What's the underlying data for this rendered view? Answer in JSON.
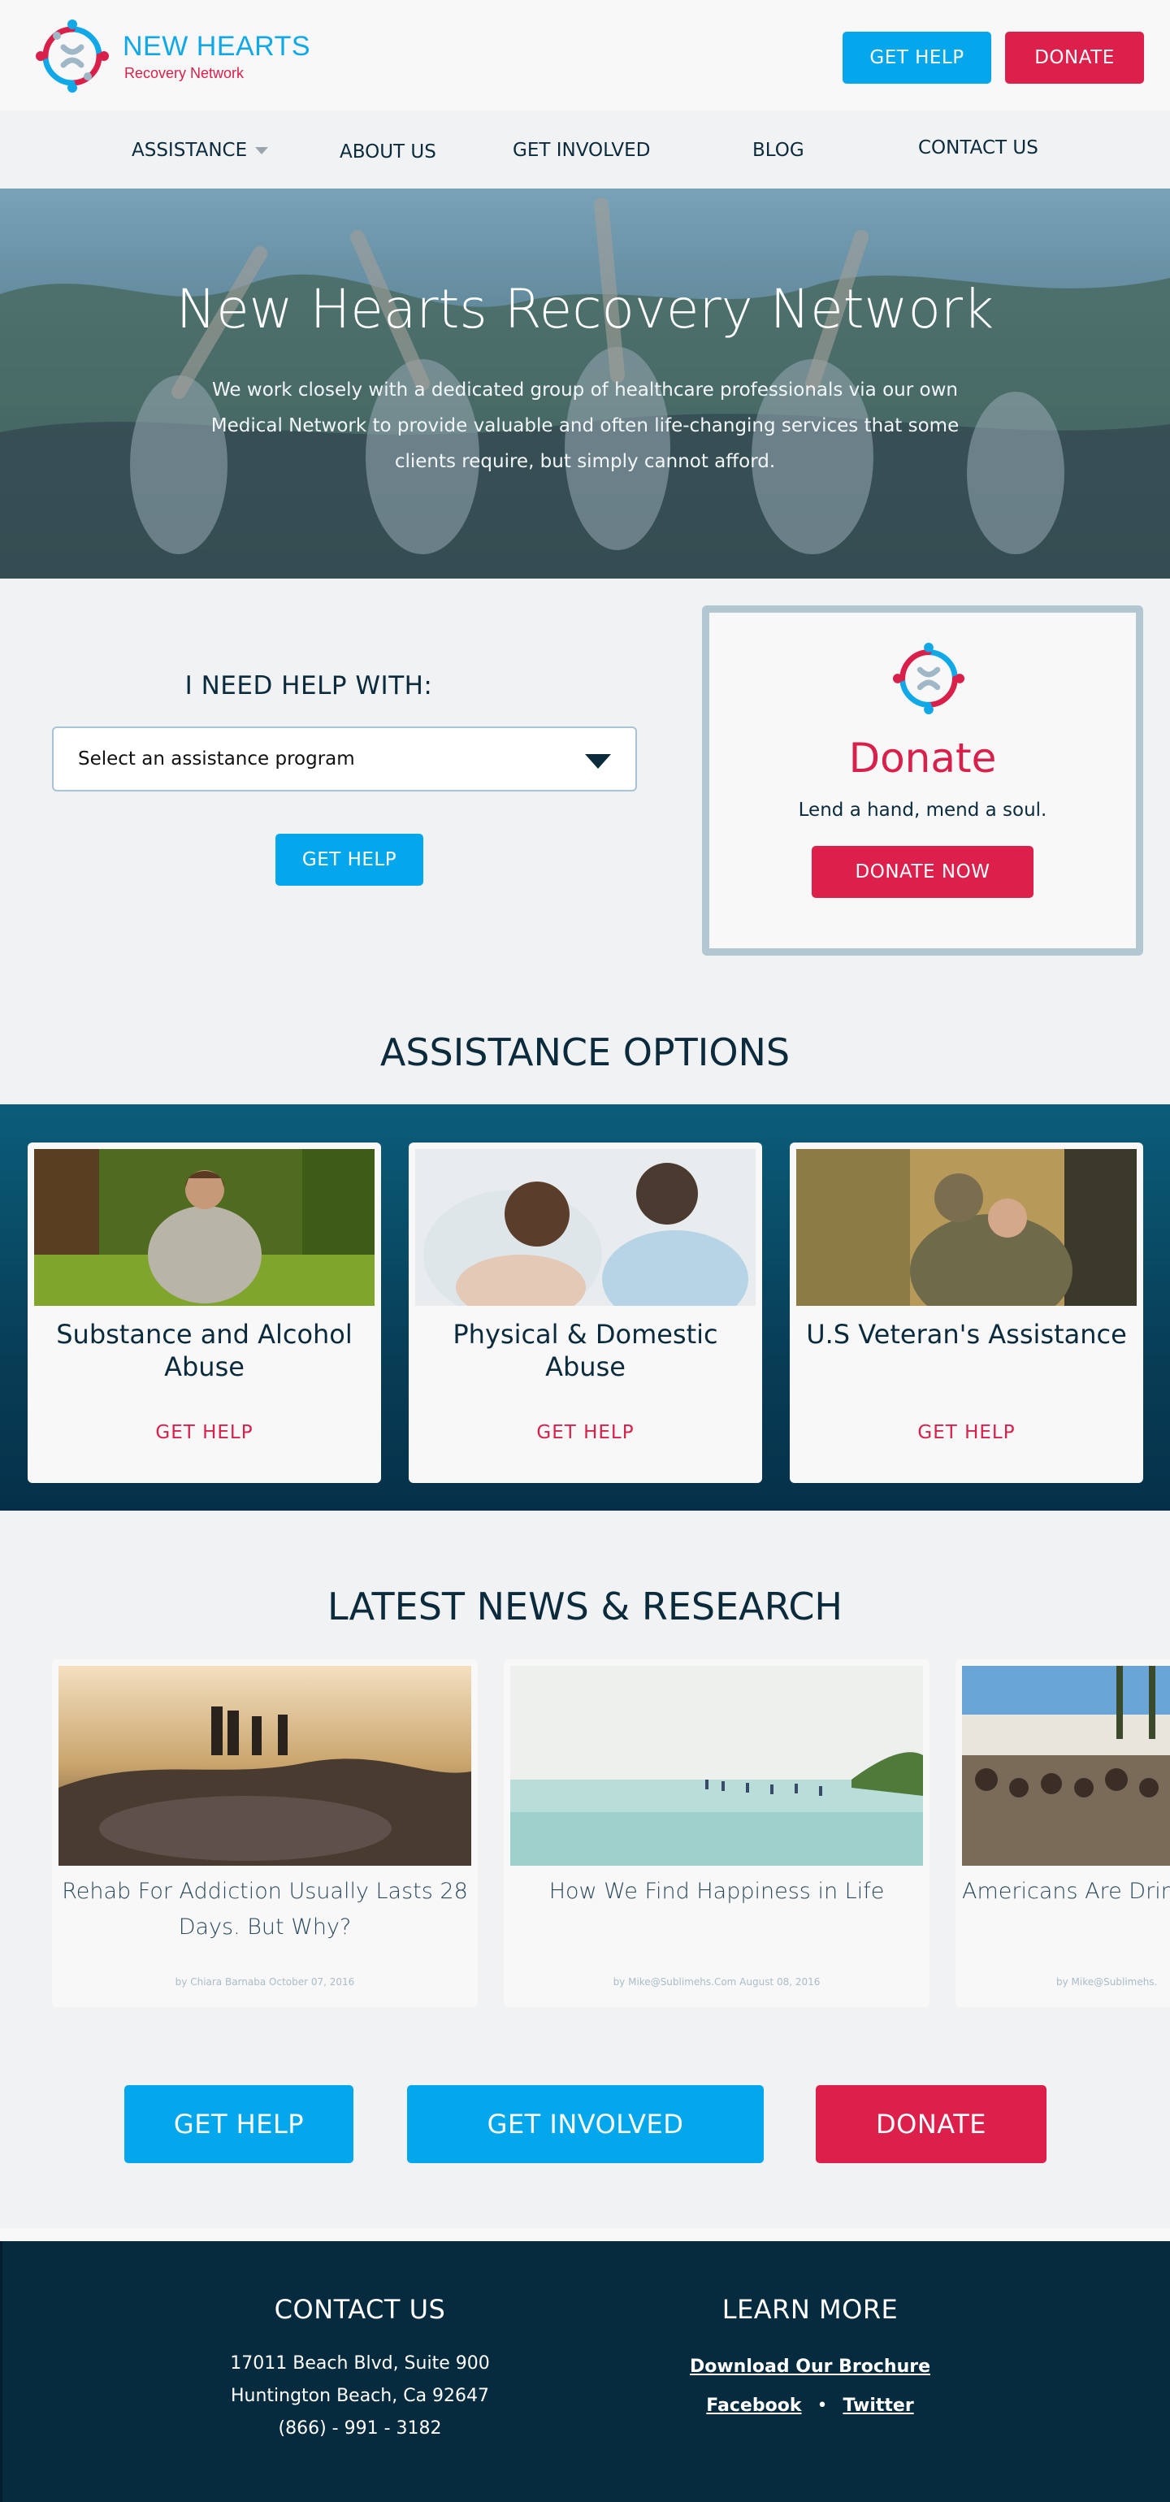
{
  "header": {
    "brand_name": "NEW HEARTS",
    "brand_sub": "Recovery Network",
    "get_help": "GET HELP",
    "donate": "DONATE"
  },
  "nav": {
    "assistance": "ASSISTANCE",
    "about": "ABOUT US",
    "involved": "GET INVOLVED",
    "blog": "BLOG",
    "contact": "CONTACT US"
  },
  "hero": {
    "title": "New Hearts Recovery Network",
    "text": "We work closely with a dedicated group of healthcare professionals via our own Medical Network to provide valuable and often life-changing services that some clients require, but simply cannot afford."
  },
  "help": {
    "heading": "I NEED HELP WITH:",
    "select_value": "Select an assistance program",
    "button": "GET HELP"
  },
  "donate_box": {
    "title": "Donate",
    "tagline": "Lend a hand, mend a soul.",
    "button": "DONATE NOW"
  },
  "assistance": {
    "heading": "ASSISTANCE OPTIONS",
    "cards": [
      {
        "title": "Substance and Alcohol Abuse",
        "link": "GET HELP"
      },
      {
        "title": "Physical & Domestic Abuse",
        "link": "GET HELP"
      },
      {
        "title": "U.S Veteran's Assistance",
        "link": "GET HELP"
      }
    ]
  },
  "news": {
    "heading": "LATEST NEWS & RESEARCH",
    "items": [
      {
        "title": "Rehab For Addiction Usually Lasts 28 Days. But Why?",
        "meta": "by Chiara Barnaba October 07, 2016"
      },
      {
        "title": "How We Find Happiness in Life",
        "meta": "by Mike@Sublimehs.Com August 08, 2016"
      },
      {
        "title": "Americans Are Drin Especially",
        "meta": "by Mike@Sublimehs."
      }
    ]
  },
  "cta": {
    "get_help": "GET HELP",
    "involved": "GET INVOLVED",
    "donate": "DONATE"
  },
  "footer": {
    "contact_heading": "CONTACT US",
    "address1": "17011 Beach Blvd, Suite 900",
    "address2": "Huntington Beach, Ca 92647",
    "phone": "(866) - 991 - 3182",
    "learn_heading": "LEARN MORE",
    "brochure": "Download Our Brochure",
    "facebook": "Facebook",
    "separator": "•",
    "twitter": "Twitter"
  },
  "icons": {
    "logo": "people-circle-logo-icon",
    "dropdown": "caret-down-icon"
  },
  "colors": {
    "brand_blue": "#04a7ec",
    "brand_red": "#dd1f4b",
    "navy": "#0b2b3d",
    "footer": "#062b3f"
  }
}
